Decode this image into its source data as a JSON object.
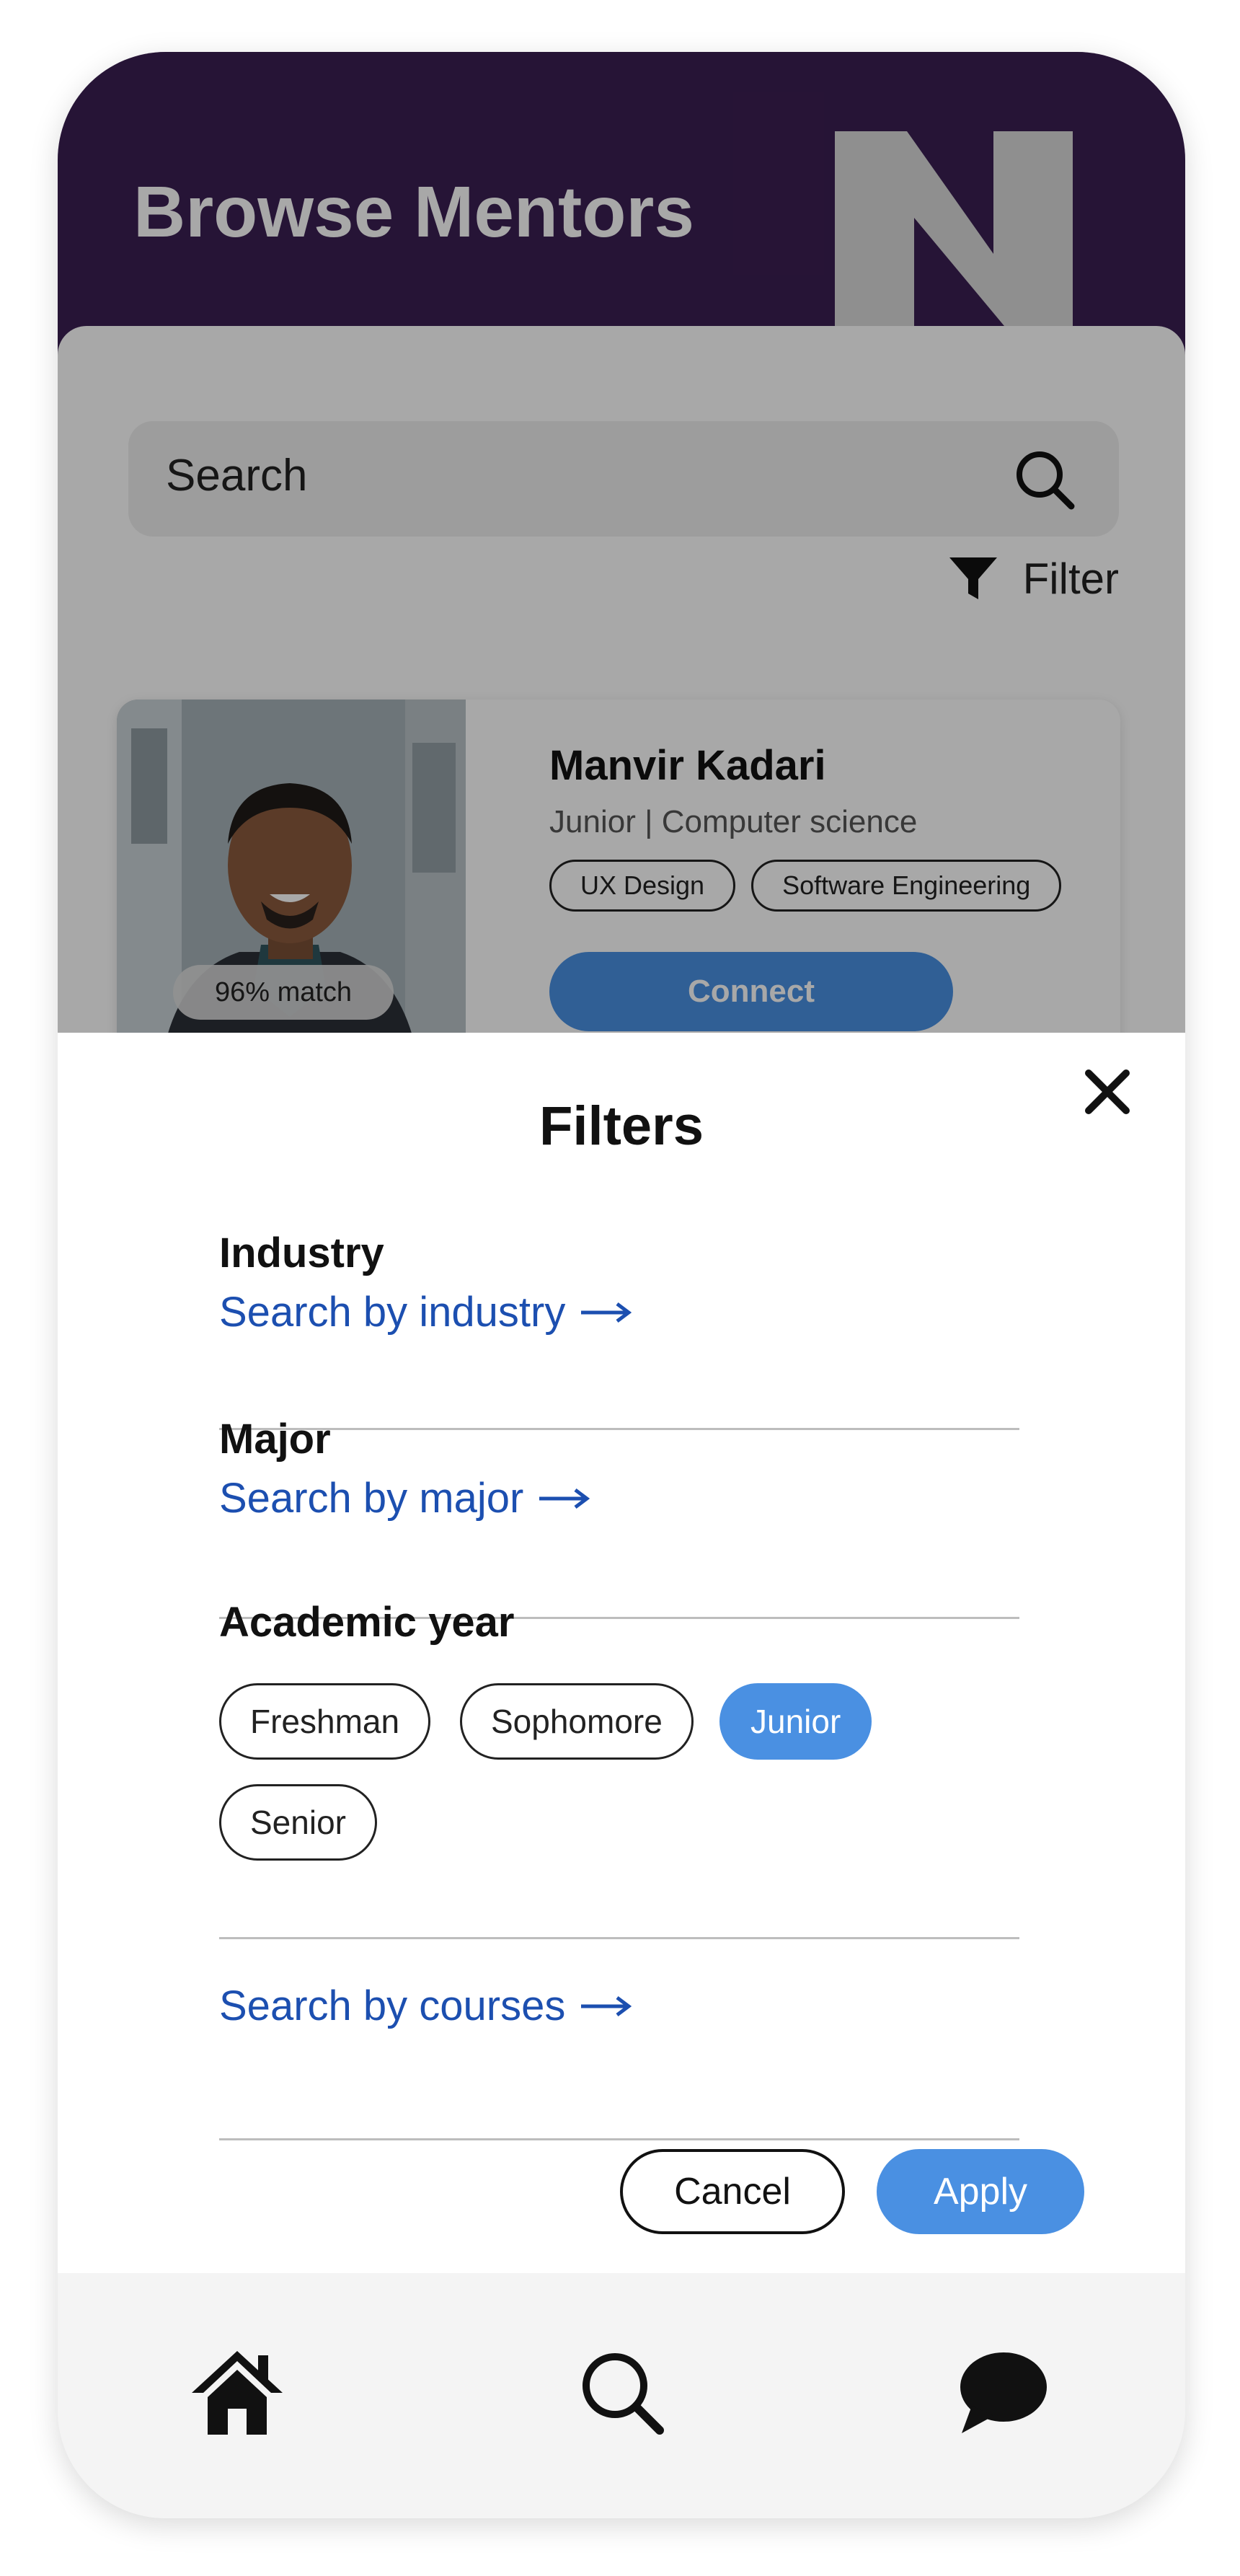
{
  "header": {
    "title": "Browse Mentors"
  },
  "search": {
    "placeholder": "Search"
  },
  "filter_button": {
    "label": "Filter"
  },
  "mentor_card": {
    "name": "Manvir Kadari",
    "meta": "Junior | Computer science",
    "match": "96% match",
    "tags": [
      "UX Design",
      "Software Engineering"
    ],
    "connect_label": "Connect"
  },
  "filters_sheet": {
    "title": "Filters",
    "industry": {
      "label": "Industry",
      "link": "Search by industry"
    },
    "major": {
      "label": "Major",
      "link": "Search by major"
    },
    "academic_year": {
      "label": "Academic year",
      "options": [
        "Freshman",
        "Sophomore",
        "Junior",
        "Senior"
      ],
      "selected": "Junior"
    },
    "courses": {
      "link": "Search by courses"
    },
    "cancel_label": "Cancel",
    "apply_label": "Apply"
  },
  "bottom_nav": {
    "items": [
      "home-icon",
      "search-icon",
      "chat-icon"
    ]
  },
  "colors": {
    "header_bg": "#3b1f52",
    "accent": "#4a90e2",
    "link": "#1c4fb0"
  }
}
